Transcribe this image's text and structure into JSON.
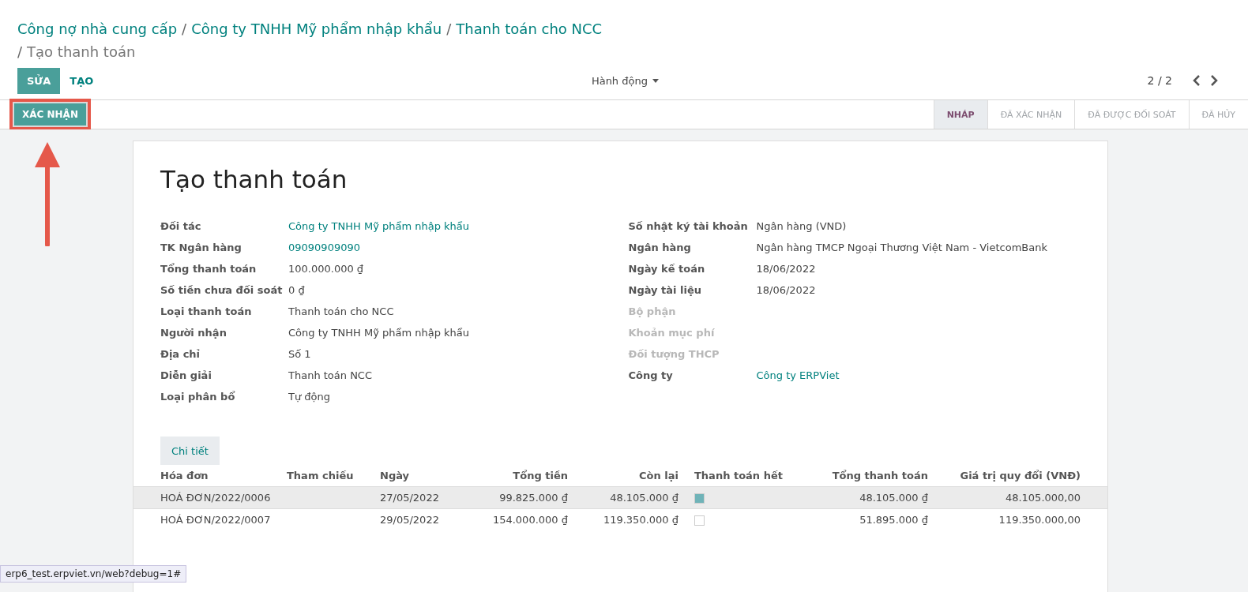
{
  "breadcrumbs": [
    {
      "label": "Công nợ nhà cung cấp",
      "kind": "link"
    },
    {
      "separator": "/",
      "label": "Công ty TNHH Mỹ phẩm nhập khẩu",
      "kind": "link"
    },
    {
      "separator": "/",
      "label": "Thanh toán cho NCC",
      "kind": "link"
    },
    {
      "separator": "/",
      "label": "Tạo thanh toán",
      "kind": "current"
    }
  ],
  "buttons": [
    {
      "label": "SỬA",
      "kind": "primary"
    },
    {
      "label": "TẠO",
      "kind": "secondary"
    }
  ],
  "action_menu": {
    "label": "Hành động"
  },
  "pager": {
    "value": "2 / 2"
  },
  "confirm_button": {
    "label": "XÁC NHẬN",
    "highlighted": true
  },
  "stages": [
    {
      "label": "NHÁP",
      "selected": true
    },
    {
      "label": "ĐÃ XÁC NHẬN",
      "selected": false
    },
    {
      "label": "ĐÃ ĐƯỢC ĐỐI SOÁT",
      "selected": false
    },
    {
      "label": "ĐÃ HỦY",
      "selected": false
    }
  ],
  "form": {
    "title": "Tạo thanh toán",
    "left_fields": [
      {
        "label": "Đối tác",
        "value": "Công ty TNHH Mỹ phẩm nhập khẩu",
        "kind": "link",
        "disabled": false
      },
      {
        "label": "TK Ngân hàng",
        "value": "09090909090",
        "kind": "link",
        "disabled": false
      },
      {
        "label": "Tổng thanh toán",
        "value": "100.000.000 ₫",
        "kind": "text",
        "disabled": false
      },
      {
        "label": "Số tiền chưa đối soát",
        "value": "0 ₫",
        "kind": "text",
        "disabled": false
      },
      {
        "label": "Loại thanh toán",
        "value": "Thanh toán cho NCC",
        "kind": "text",
        "disabled": false
      },
      {
        "label": "Người nhận",
        "value": "Công ty TNHH Mỹ phẩm nhập khẩu",
        "kind": "text",
        "disabled": false
      },
      {
        "label": "Địa chỉ",
        "value": "Số 1",
        "kind": "text",
        "disabled": false
      },
      {
        "label": "Diễn giải",
        "value": "Thanh toán NCC",
        "kind": "text",
        "disabled": false
      },
      {
        "label": "Loại phân bổ",
        "value": "Tự động",
        "kind": "text",
        "disabled": false
      }
    ],
    "right_fields": [
      {
        "label": "Số nhật ký tài khoản",
        "value": "Ngân hàng (VND)",
        "kind": "text",
        "disabled": false
      },
      {
        "label": "Ngân hàng",
        "value": "Ngân hàng TMCP Ngoại Thương Việt Nam - VietcomBank",
        "kind": "text",
        "disabled": false
      },
      {
        "label": "Ngày kế toán",
        "value": "18/06/2022",
        "kind": "text",
        "disabled": false
      },
      {
        "label": "Ngày tài liệu",
        "value": "18/06/2022",
        "kind": "text",
        "disabled": false
      },
      {
        "label": "Bộ phận",
        "disabled": true
      },
      {
        "label": "Khoản mục phí",
        "disabled": true
      },
      {
        "label": "Đối tượng THCP",
        "disabled": true
      },
      {
        "label": "Công ty",
        "value": "Công ty ERPViet",
        "kind": "link",
        "disabled": false
      }
    ],
    "tabs": [
      {
        "label": "Chi tiết",
        "selected": true
      }
    ],
    "table": {
      "columns": [
        "Hóa đơn",
        "Tham chiếu",
        "Ngày",
        "Tổng tiền",
        "Còn lại",
        "Thanh toán hết",
        "Tổng thanh toán",
        "Giá trị quy đổi (VNĐ)"
      ],
      "rows": [
        {
          "selected": true,
          "invoice": "HOÁ ĐƠN/2022/0006",
          "date": "27/05/2022",
          "total": "99.825.000 ₫",
          "remaining": "48.105.000 ₫",
          "paid_in_full": true,
          "payment": "48.105.000 ₫",
          "converted": "48.105.000,00"
        },
        {
          "selected": false,
          "invoice": "HOÁ ĐƠN/2022/0007",
          "date": "29/05/2022",
          "total": "154.000.000 ₫",
          "remaining": "119.350.000 ₫",
          "paid_in_full": false,
          "payment": "51.895.000 ₫",
          "converted": "119.350.000,00"
        }
      ]
    }
  },
  "status_url": "erp6_test.erpviet.vn/web?debug=1#"
}
